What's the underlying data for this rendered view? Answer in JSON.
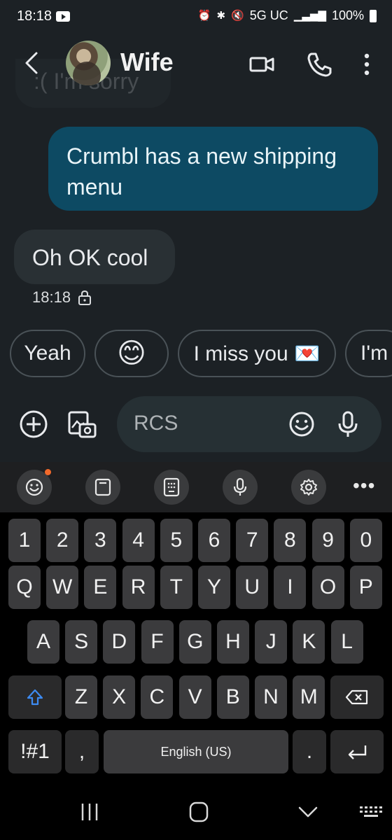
{
  "status_bar": {
    "time": "18:18",
    "network": "5G UC",
    "battery": "100%"
  },
  "header": {
    "contact_name": "Wife"
  },
  "messages": {
    "previous_partial": ":( I'm sorry",
    "outgoing": "Crumbl has a new shipping menu",
    "incoming": "Oh OK cool",
    "timestamp": "18:18"
  },
  "smart_replies": [
    {
      "label": "Yeah"
    },
    {
      "label": "😊"
    },
    {
      "label": "I miss you 💌"
    },
    {
      "label": "I'm"
    }
  ],
  "compose": {
    "placeholder": "RCS"
  },
  "keyboard": {
    "number_row": [
      "1",
      "2",
      "3",
      "4",
      "5",
      "6",
      "7",
      "8",
      "9",
      "0"
    ],
    "row1": [
      "Q",
      "W",
      "E",
      "R",
      "T",
      "Y",
      "U",
      "I",
      "O",
      "P"
    ],
    "row2": [
      "A",
      "S",
      "D",
      "F",
      "G",
      "H",
      "J",
      "K",
      "L"
    ],
    "row3": [
      "Z",
      "X",
      "C",
      "V",
      "B",
      "N",
      "M"
    ],
    "symbols_key": "!#1",
    "comma_key": ",",
    "space_key": "English (US)",
    "period_key": "."
  },
  "colors": {
    "outgoing_bubble": "#0d4a63",
    "incoming_bubble": "#293034",
    "background": "#1c2125",
    "notification_dot": "#f36a2b",
    "shift_accent": "#3d8bf2"
  }
}
